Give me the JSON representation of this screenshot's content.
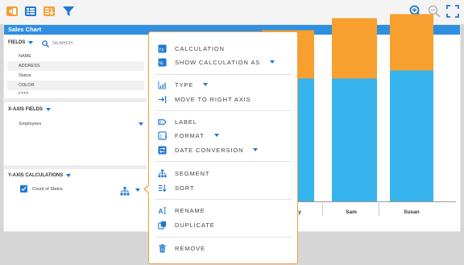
{
  "toolbar": {
    "icons": [
      "collapse-left-icon",
      "table-icon",
      "sort-icon",
      "filter-icon",
      "zoom-in-icon",
      "zoom-out-icon",
      "fullscreen-icon"
    ]
  },
  "panel": {
    "title": "Sales Chart"
  },
  "fields": {
    "label": "FIELDS",
    "search_placeholder": "SEARCH",
    "items": [
      "NAME",
      "ADDRESS",
      "Status",
      "COLOR",
      "CITY"
    ]
  },
  "x_axis": {
    "label": "X-AXIS FIELDS",
    "value": "Employees"
  },
  "y_axis": {
    "label": "Y-AXIS CALCULATIONS",
    "item": "Count of Status"
  },
  "context_menu": {
    "items": [
      {
        "label": "CALCULATION",
        "icon": "calculation-icon"
      },
      {
        "label": "SHOW CALCULATION AS",
        "icon": "show-calculation-icon",
        "has_submenu": true
      },
      {
        "label": "TYPE",
        "icon": "chart-type-icon",
        "has_submenu": true
      },
      {
        "label": "MOVE TO RIGHT AXIS",
        "icon": "move-axis-icon"
      },
      {
        "label": "LABEL",
        "icon": "label-icon"
      },
      {
        "label": "FORMAT",
        "icon": "format-icon",
        "has_submenu": true
      },
      {
        "label": "DATE CONVERSION",
        "icon": "date-conversion-icon",
        "has_submenu": true
      },
      {
        "label": "SEGMENT",
        "icon": "segment-icon"
      },
      {
        "label": "SORT",
        "icon": "sort-icon"
      },
      {
        "label": "RENAME",
        "icon": "rename-icon"
      },
      {
        "label": "DUPLICATE",
        "icon": "duplicate-icon"
      },
      {
        "label": "REMOVE",
        "icon": "trash-icon"
      }
    ]
  },
  "chart_data": {
    "type": "bar",
    "stacked": true,
    "categories": [
      "",
      "Sam",
      "Susan"
    ],
    "series": [
      {
        "values": [
          0.61,
          0.61,
          0.65
        ]
      },
      {
        "values": [
          0.24,
          0.3,
          0.28
        ]
      }
    ],
    "colors": [
      "#35b4ee",
      "#f7a030"
    ],
    "visible_tick_fragment": "y"
  },
  "colors": {
    "accent": "#1f78d1",
    "header": "#2f8fe0",
    "menu_border": "#f0a040"
  }
}
